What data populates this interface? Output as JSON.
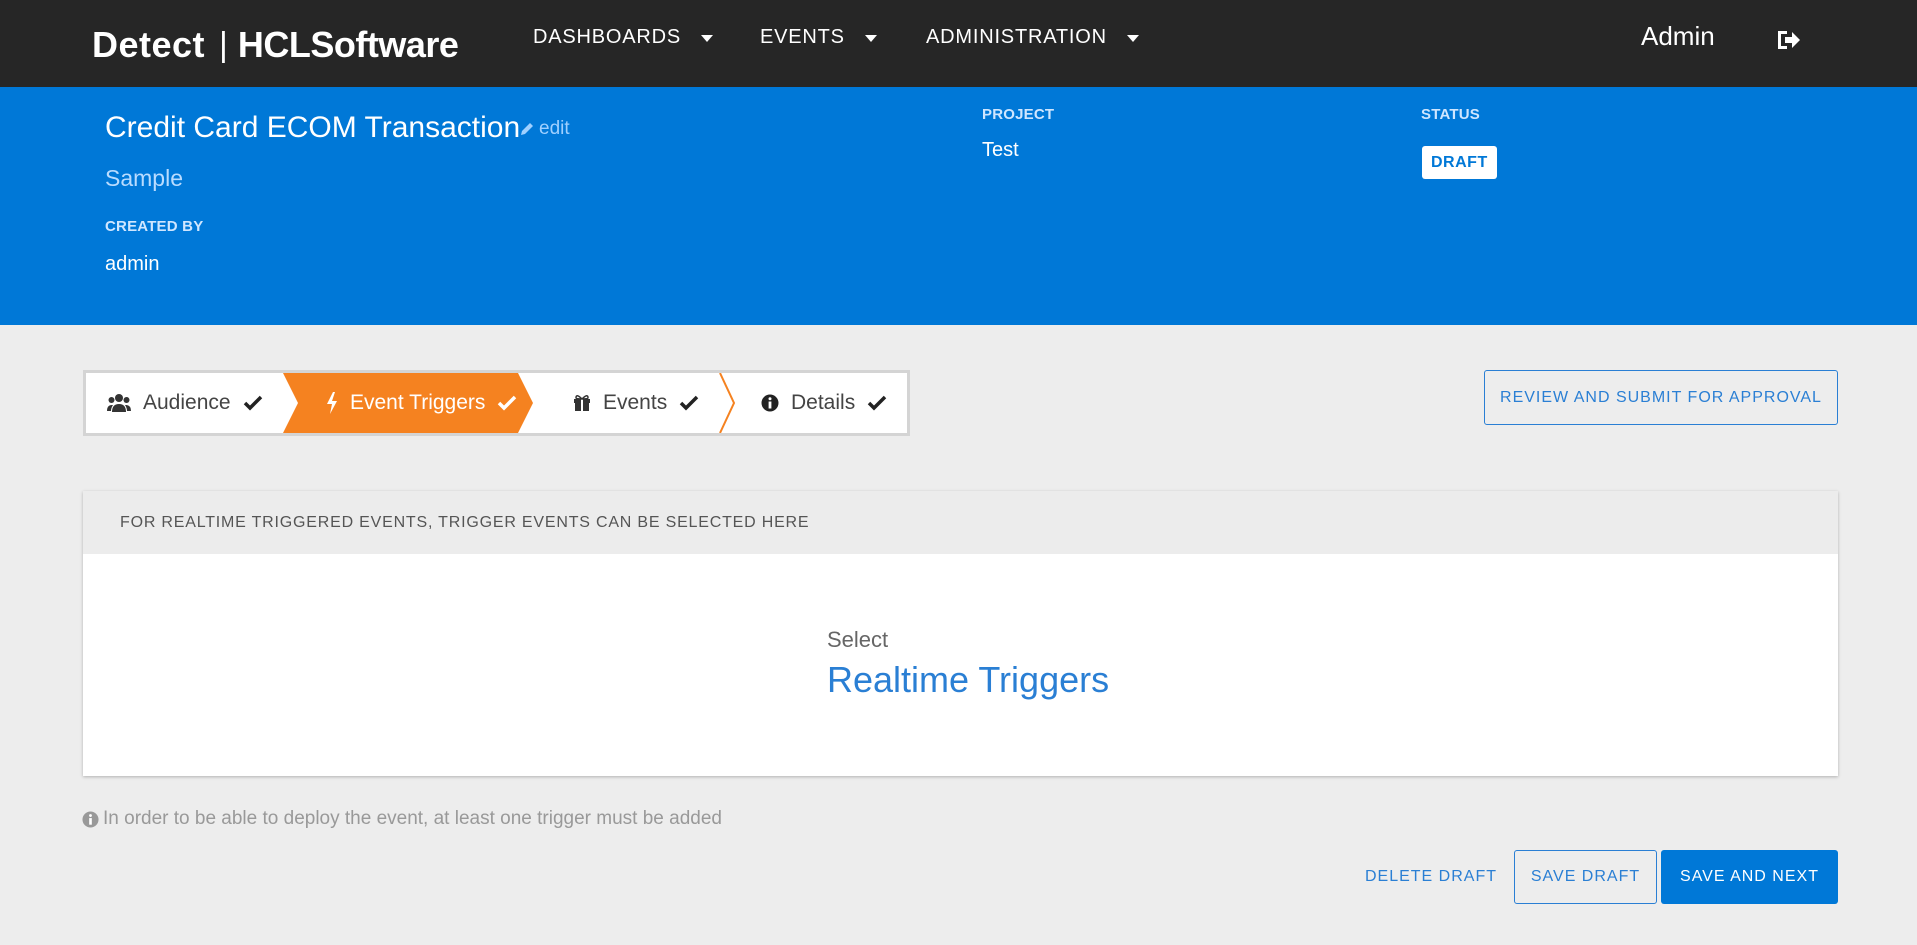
{
  "brand": {
    "detect": "Detect",
    "separator": "|",
    "company": "HCLSoftware"
  },
  "nav": {
    "items": [
      {
        "label": "DASHBOARDS"
      },
      {
        "label": "EVENTS"
      },
      {
        "label": "ADMINISTRATION"
      }
    ],
    "user": "Admin",
    "logout_icon": "sign-out-icon"
  },
  "header": {
    "title": "Credit Card ECOM Transaction",
    "edit_label": "edit",
    "subtitle": "Sample",
    "created_by_label": "CREATED BY",
    "created_by": "admin",
    "project_label": "PROJECT",
    "project": "Test",
    "status_label": "STATUS",
    "status": "DRAFT",
    "background_color": "#0078d7"
  },
  "stepper": {
    "steps": [
      {
        "label": "Audience",
        "icon": "users-icon",
        "completed": true,
        "active": false
      },
      {
        "label": "Event Triggers",
        "icon": "bolt-icon",
        "completed": true,
        "active": true
      },
      {
        "label": "Events",
        "icon": "gift-icon",
        "completed": true,
        "active": false
      },
      {
        "label": "Details",
        "icon": "info-circle-icon",
        "completed": true,
        "active": false
      }
    ],
    "active_color": "#f58220"
  },
  "actions": {
    "review_submit": "REVIEW AND SUBMIT FOR APPROVAL",
    "delete_draft": "DELETE DRAFT",
    "save_draft": "SAVE DRAFT",
    "save_next": "SAVE AND NEXT"
  },
  "trigger_card": {
    "heading": "FOR REALTIME TRIGGERED EVENTS, TRIGGER EVENTS CAN BE SELECTED HERE",
    "select_label": "Select",
    "link_label": "Realtime Triggers"
  },
  "info_note": "In order to be able to deploy the event, at least one trigger must be added"
}
